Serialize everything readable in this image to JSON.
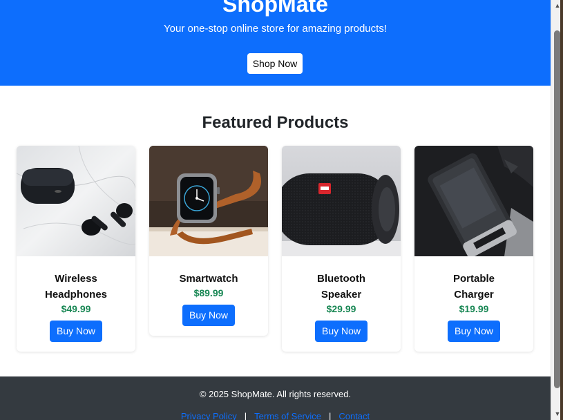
{
  "hero": {
    "title": "ShopMate",
    "subtitle": "Your one-stop online store for amazing products!",
    "cta_label": "Shop Now"
  },
  "featured": {
    "title": "Featured Products",
    "products": [
      {
        "name": "Wireless Headphones",
        "price": "$49.99",
        "buy_label": "Buy Now",
        "image": "earbuds-image"
      },
      {
        "name": "Smartwatch",
        "price": "$89.99",
        "buy_label": "Buy Now",
        "image": "smartwatch-image"
      },
      {
        "name": "Bluetooth Speaker",
        "price": "$29.99",
        "buy_label": "Buy Now",
        "image": "speaker-image"
      },
      {
        "name": "Portable Charger",
        "price": "$19.99",
        "buy_label": "Buy Now",
        "image": "charger-image"
      }
    ]
  },
  "footer": {
    "copyright": "© 2025 ShopMate. All rights reserved.",
    "links": [
      "Privacy Policy",
      "Terms of Service",
      "Contact"
    ],
    "separator": "|"
  },
  "colors": {
    "primary": "#0d6efd",
    "price": "#198754",
    "footer_bg": "#343a40"
  }
}
